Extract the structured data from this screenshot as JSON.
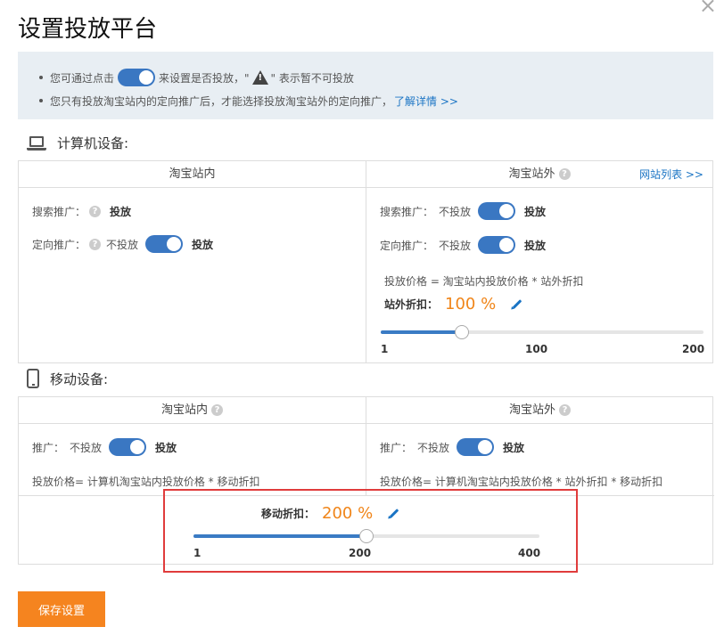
{
  "title": "设置投放平台",
  "close": "×",
  "notice": {
    "line1_a": "您可通过点击",
    "line1_b": "来设置是否投放，\"",
    "line1_c": "\" 表示暂不可投放",
    "line2_text": "您只有投放淘宝站内的定向推广后，才能选择投放淘宝站外的定向推广，",
    "line2_link": "了解详情 >>"
  },
  "pc": {
    "heading": "计算机设备:",
    "inside": {
      "header": "淘宝站内",
      "search_label": "搜索推广：",
      "search_state": "投放",
      "target_label": "定向推广：",
      "target_off": "不投放",
      "target_on": "投放"
    },
    "outside": {
      "header": "淘宝站外",
      "site_link": "网站列表 >>",
      "search_label": "搜索推广：",
      "search_off": "不投放",
      "search_on": "投放",
      "target_label": "定向推广：",
      "target_off": "不投放",
      "target_on": "投放",
      "formula": "投放价格 = 淘宝站内投放价格 * 站外折扣",
      "discount_label": "站外折扣：",
      "discount_value": "100 %",
      "slider": {
        "min": "1",
        "mid": "100",
        "max": "200",
        "value": 100,
        "range": [
          1,
          200
        ]
      }
    }
  },
  "mobile": {
    "heading": "移动设备:",
    "inside": {
      "header": "淘宝站内",
      "promo_label": "推广：",
      "promo_off": "不投放",
      "promo_on": "投放",
      "formula": "投放价格= 计算机淘宝站内投放价格 * 移动折扣"
    },
    "outside": {
      "header": "淘宝站外",
      "promo_label": "推广：",
      "promo_off": "不投放",
      "promo_on": "投放",
      "formula": "投放价格= 计算机淘宝站内投放价格 * 站外折扣 * 移动折扣"
    },
    "discount_label": "移动折扣：",
    "discount_value": "200 %",
    "slider": {
      "min": "1",
      "mid": "200",
      "max": "400",
      "value": 200,
      "range": [
        1,
        400
      ]
    }
  },
  "save_button": "保存设置",
  "colors": {
    "accent": "#3a77c2",
    "orange": "#f5841f",
    "highlight": "#e03c3c",
    "notice_bg": "#e8eef3"
  }
}
